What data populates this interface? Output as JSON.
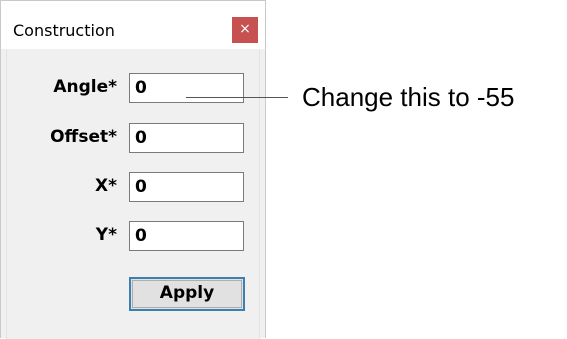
{
  "window": {
    "title": "Construction",
    "close_glyph": "×"
  },
  "fields": [
    {
      "label": "Angle*",
      "value": "0"
    },
    {
      "label": "Offset*",
      "value": "0"
    },
    {
      "label": "X*",
      "value": "0"
    },
    {
      "label": "Y*",
      "value": "0"
    }
  ],
  "buttons": {
    "apply_label": "Apply"
  },
  "annotation": {
    "text": "Change this to -55"
  },
  "colors": {
    "close_button": "#c75050",
    "focus_border": "#3c7fb1",
    "dialog_background": "#f0f0f0"
  }
}
